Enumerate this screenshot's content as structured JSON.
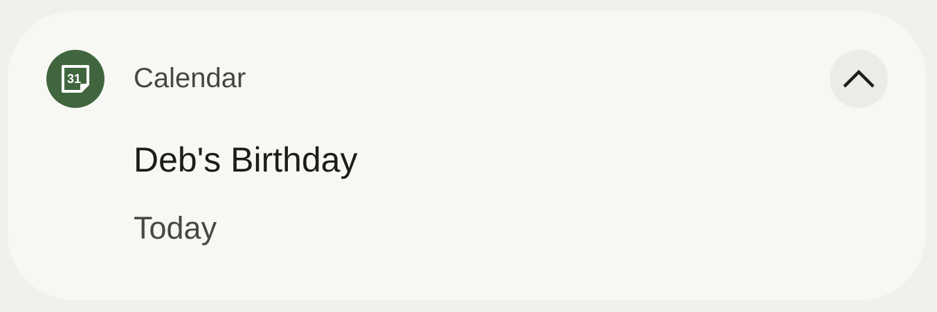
{
  "notification": {
    "app_name": "Calendar",
    "app_icon": "calendar-icon",
    "app_icon_text": "31",
    "title": "Deb's Birthday",
    "subtitle": "Today",
    "collapse_icon": "chevron-up-icon",
    "colors": {
      "card_background": "#f7f8f3",
      "page_background": "#f0f0ec",
      "app_icon_background": "#41663f",
      "collapse_button_background": "#ebece7"
    }
  }
}
